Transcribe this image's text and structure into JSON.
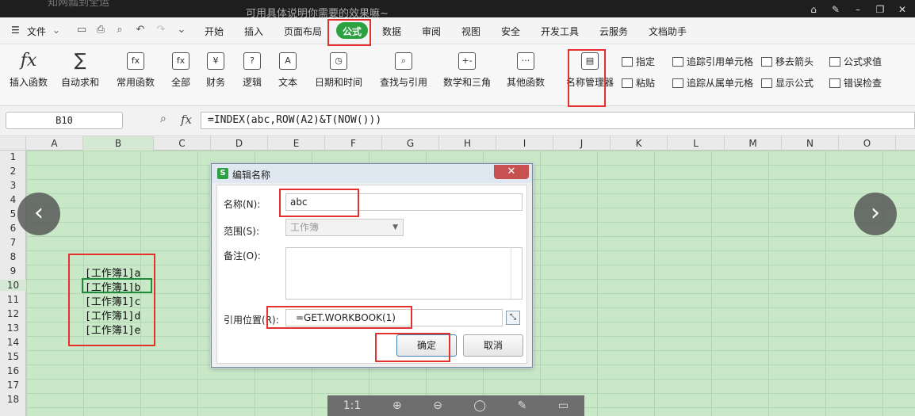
{
  "top_strip": {
    "title": "知网瓢到全运",
    "subtitle": "可用具体说明你需要的效果嘛~"
  },
  "window_controls": [
    "home-icon",
    "pin-icon",
    "minimize-icon",
    "restore-icon",
    "close-icon"
  ],
  "menu": {
    "file_label": "文件",
    "tabs": [
      "开始",
      "插入",
      "页面布局",
      "公式",
      "数据",
      "审阅",
      "视图",
      "安全",
      "开发工具",
      "云服务",
      "文档助手"
    ],
    "active_tab": "公式",
    "accent": "#2ca141"
  },
  "ribbon": {
    "big": [
      {
        "label": "插入函数",
        "icon": "fx"
      },
      {
        "label": "自动求和",
        "icon": "∑"
      },
      {
        "label": "常用函数",
        "icon": "fx"
      },
      {
        "label": "全部",
        "icon": "fx"
      },
      {
        "label": "财务",
        "icon": "¥"
      },
      {
        "label": "逻辑",
        "icon": "?"
      },
      {
        "label": "文本",
        "icon": "A"
      },
      {
        "label": "日期和时间",
        "icon": "◷"
      },
      {
        "label": "查找与引用",
        "icon": "⌕"
      },
      {
        "label": "数学和三角",
        "icon": "+-"
      },
      {
        "label": "其他函数",
        "icon": "···"
      },
      {
        "label": "名称管理器",
        "icon": "▤"
      }
    ],
    "small": {
      "specify": "指定",
      "paste": "粘贴",
      "trace_precedents": "追踪引用单元格",
      "trace_dependents": "追踪从属单元格",
      "remove_arrows": "移去箭头",
      "show_formulas": "显示公式",
      "evaluate_formula": "公式求值",
      "error_check": "错误检查"
    }
  },
  "formula_bar": {
    "name_box": "B10",
    "fx_label": "fx",
    "formula": "=INDEX(abc,ROW(A2)&T(NOW()))"
  },
  "columns": [
    "A",
    "B",
    "C",
    "D",
    "E",
    "F",
    "G",
    "H",
    "I",
    "J",
    "K",
    "L",
    "M",
    "N",
    "O"
  ],
  "rows": [
    "1",
    "2",
    "3",
    "4",
    "5",
    "6",
    "7",
    "8",
    "9",
    "10",
    "11",
    "12",
    "13",
    "14",
    "15",
    "16",
    "17",
    "18"
  ],
  "cells": [
    "[工作簿1]a",
    "[工作簿1]b",
    "[工作簿1]c",
    "[工作簿1]d",
    "[工作簿1]e"
  ],
  "dialog": {
    "title": "编辑名称",
    "name_label": "名称(N):",
    "name_value": "abc",
    "scope_label": "范围(S):",
    "scope_value": "工作簿",
    "comment_label": "备注(O):",
    "ref_label": "引用位置(R):",
    "ref_value": "=GET.WORKBOOK(1)",
    "ok": "确定",
    "cancel": "取消"
  },
  "nav": {
    "prev": "‹",
    "next": "›"
  },
  "bottom_toolbar": {
    "ratio": "1:1"
  },
  "highlight_color": "#e4312d"
}
